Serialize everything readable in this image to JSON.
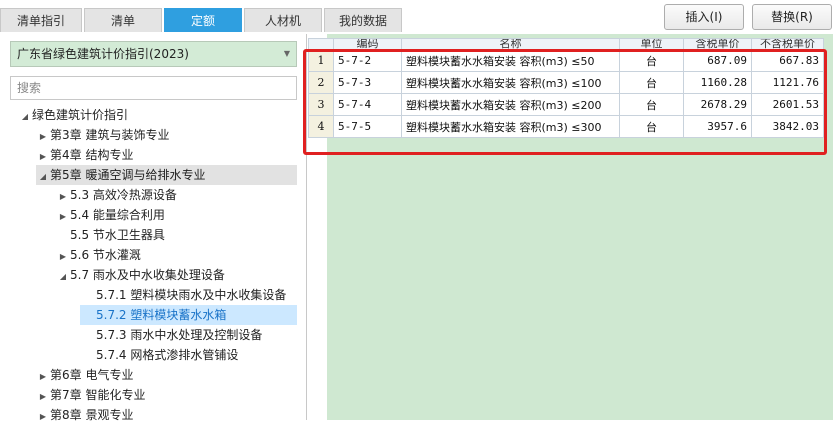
{
  "tabs": [
    "清单指引",
    "清单",
    "定额",
    "人材机",
    "我的数据"
  ],
  "toolbar": {
    "insert_label": "插入(I)",
    "replace_label": "替换(R)"
  },
  "guide_select": {
    "value": "广东省绿色建筑计价指引(2023)"
  },
  "search": {
    "placeholder": "搜索"
  },
  "tree": [
    {
      "label": "绿色建筑计价指引",
      "arrow": "◢"
    },
    {
      "label": "第3章 建筑与装饰专业",
      "arrow": "▶"
    },
    {
      "label": "第4章 结构专业",
      "arrow": "▶"
    },
    {
      "label": "第5章 暖通空调与给排水专业",
      "arrow": "◢"
    },
    {
      "label": "5.3 高效冷热源设备",
      "arrow": "▶"
    },
    {
      "label": "5.4 能量综合利用",
      "arrow": "▶"
    },
    {
      "label": "5.5 节水卫生器具",
      "arrow": ""
    },
    {
      "label": "5.6 节水灌溉",
      "arrow": "▶"
    },
    {
      "label": "5.7 雨水及中水收集处理设备",
      "arrow": "◢"
    },
    {
      "label": "5.7.1 塑料模块雨水及中水收集设备",
      "arrow": ""
    },
    {
      "label": "5.7.2 塑料模块蓄水水箱",
      "arrow": ""
    },
    {
      "label": "5.7.3 雨水中水处理及控制设备",
      "arrow": ""
    },
    {
      "label": "5.7.4 网格式渗排水管铺设",
      "arrow": ""
    },
    {
      "label": "第6章 电气专业",
      "arrow": "▶"
    },
    {
      "label": "第7章 智能化专业",
      "arrow": "▶"
    },
    {
      "label": "第8章 景观专业",
      "arrow": "▶"
    }
  ],
  "grid": {
    "headers": [
      "编码",
      "名称",
      "单位",
      "含税单价",
      "不含税单价"
    ],
    "rows": [
      {
        "n": "1",
        "code": "5-7-2",
        "name": "塑料模块蓄水水箱安装 容积(m3) ≤50",
        "unit": "台",
        "tax": "687.09",
        "notax": "667.83"
      },
      {
        "n": "2",
        "code": "5-7-3",
        "name": "塑料模块蓄水水箱安装 容积(m3) ≤100",
        "unit": "台",
        "tax": "1160.28",
        "notax": "1121.76"
      },
      {
        "n": "3",
        "code": "5-7-4",
        "name": "塑料模块蓄水水箱安装 容积(m3) ≤200",
        "unit": "台",
        "tax": "2678.29",
        "notax": "2601.53"
      },
      {
        "n": "4",
        "code": "5-7-5",
        "name": "塑料模块蓄水水箱安装 容积(m3) ≤300",
        "unit": "台",
        "tax": "3957.6",
        "notax": "3842.03"
      }
    ]
  }
}
